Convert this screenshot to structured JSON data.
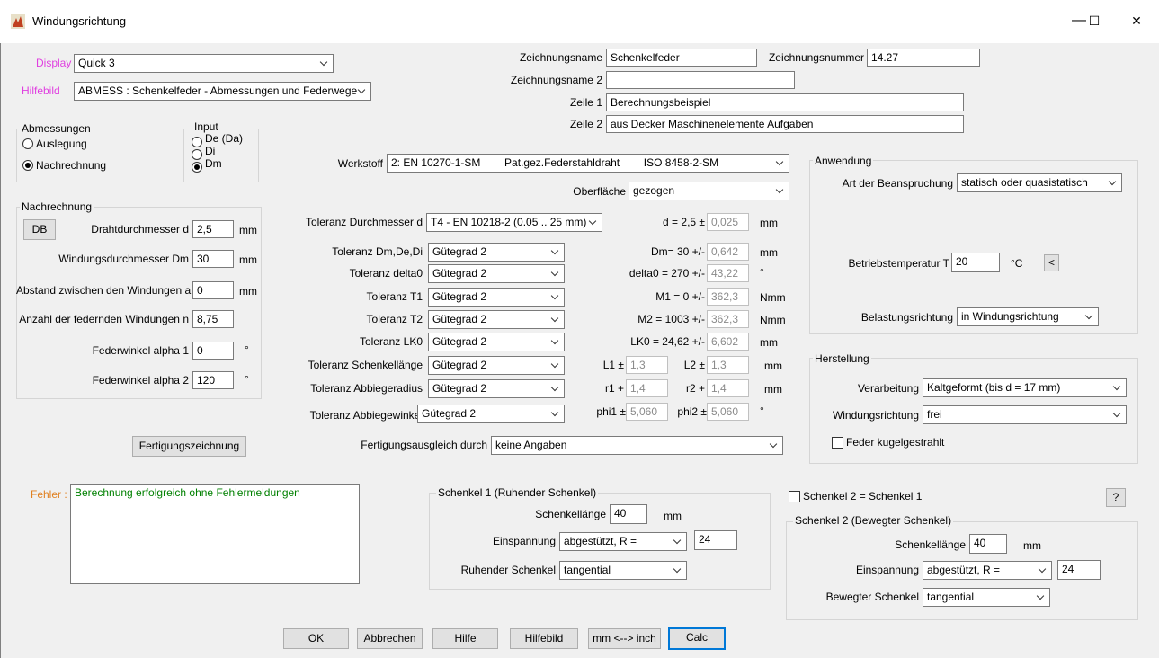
{
  "window": {
    "title": "Windungsrichtung",
    "minimize": "—",
    "maximize": "☐",
    "close": "✕"
  },
  "top": {
    "display_label": "Display",
    "display_value": "Quick 3",
    "hilfebild_label": "Hilfebild",
    "hilfebild_value": "ABMESS  : Schenkelfeder - Abmessungen und Federwege",
    "zeichnungsname_label": "Zeichnungsname",
    "zeichnungsname_value": "Schenkelfeder",
    "zeichnungsnummer_label": "Zeichnungsnummer",
    "zeichnungsnummer_value": "14.27",
    "zeichnungsname2_label": "Zeichnungsname 2",
    "zeichnungsname2_value": "",
    "zeile1_label": "Zeile 1",
    "zeile1_value": "Berechnungsbeispiel",
    "zeile2_label": "Zeile 2",
    "zeile2_value": "aus Decker Maschinenelemente Aufgaben"
  },
  "abmessungen": {
    "title": "Abmessungen",
    "auslegung": "Auslegung",
    "nachrechnung": "Nachrechnung"
  },
  "input_group": {
    "title": "Input",
    "de": "De (Da)",
    "di": "Di",
    "dm": "Dm"
  },
  "nachrechnung": {
    "title": "Nachrechnung",
    "db_button": "DB",
    "rows": [
      {
        "label": "Drahtdurchmesser d",
        "value": "2,5",
        "unit": "mm"
      },
      {
        "label": "Windungsdurchmesser Dm",
        "value": "30",
        "unit": "mm"
      },
      {
        "label": "Abstand zwischen den Windungen a",
        "value": "0",
        "unit": "mm"
      },
      {
        "label": "Anzahl der federnden Windungen n",
        "value": "8,75",
        "unit": ""
      },
      {
        "label": "Federwinkel alpha 1",
        "value": "0",
        "unit": "°"
      },
      {
        "label": "Federwinkel alpha 2",
        "value": "120",
        "unit": "°"
      }
    ]
  },
  "werkstoff": {
    "label": "Werkstoff",
    "value": "2: EN 10270-1-SM        Pat.gez.Federstahldraht        ISO 8458-2-SM",
    "oberflaeche_label": "Oberfläche",
    "oberflaeche_value": "gezogen"
  },
  "toleranz": {
    "rows": [
      {
        "label": "Toleranz Durchmesser d",
        "value": "T4 - EN 10218-2 (0.05 .. 25 mm)",
        "res_label": "d = 2,5 ±",
        "res_value": "0,025",
        "unit": "mm"
      },
      {
        "label": "Toleranz Dm,De,Di",
        "value": "Gütegrad 2",
        "res_label": "Dm= 30 +/-",
        "res_value": "0,642",
        "unit": "mm"
      },
      {
        "label": "Toleranz delta0",
        "value": "Gütegrad 2",
        "res_label": "delta0 = 270 +/-",
        "res_value": "43,22",
        "unit": "°"
      },
      {
        "label": "Toleranz T1",
        "value": "Gütegrad 2",
        "res_label": "M1 = 0 +/-",
        "res_value": "362,3",
        "unit": "Nmm"
      },
      {
        "label": "Toleranz T2",
        "value": "Gütegrad 2",
        "res_label": "M2 = 1003 +/-",
        "res_value": "362,3",
        "unit": "Nmm"
      },
      {
        "label": "Toleranz LK0",
        "value": "Gütegrad 2",
        "res_label": "LK0 = 24,62 +/-",
        "res_value": "6,602",
        "unit": "mm"
      }
    ],
    "schenkel": {
      "label": "Toleranz Schenkellänge",
      "value": "Gütegrad 2",
      "l1_label": "L1 ±",
      "l1_value": "1,3",
      "l2_label": "L2 ±",
      "l2_value": "1,3",
      "unit": "mm"
    },
    "radius": {
      "label": "Toleranz Abbiegeradius",
      "value": "Gütegrad 2",
      "r1_label": "r1 +",
      "r1_value": "1,4",
      "r2_label": "r2 +",
      "r2_value": "1,4",
      "unit": "mm"
    },
    "winkel": {
      "label": "Toleranz Abbiegewinkel",
      "value": "Gütegrad 2",
      "phi1_label": "phi1 ±",
      "phi1_value": "5,060",
      "phi2_label": "phi2 ±",
      "phi2_value": "5,060",
      "unit": "°"
    },
    "fertigungsausgleich_label": "Fertigungsausgleich durch",
    "fertigungsausgleich_value": "keine Angaben"
  },
  "anwendung": {
    "title": "Anwendung",
    "beanspruchung_label": "Art der Beanspruchung",
    "beanspruchung_value": "statisch oder quasistatisch",
    "temp_label": "Betriebstemperatur T",
    "temp_value": "20",
    "temp_unit": "°C",
    "temp_button": "<",
    "belastung_label": "Belastungsrichtung",
    "belastung_value": "in Windungsrichtung"
  },
  "herstellung": {
    "title": "Herstellung",
    "verarbeitung_label": "Verarbeitung",
    "verarbeitung_value": "Kaltgeformt (bis d = 17 mm)",
    "windung_label": "Windungsrichtung",
    "windung_value": "frei",
    "kugel_label": "Feder kugelgestrahlt"
  },
  "fertigungszeichnung_button": "Fertigungszeichnung",
  "fehler": {
    "label": "Fehler :",
    "text": "Berechnung erfolgreich ohne Fehlermeldungen"
  },
  "schenkel1": {
    "title": "Schenkel 1 (Ruhender Schenkel)",
    "laenge_label": "Schenkellänge",
    "laenge_value": "40",
    "laenge_unit": "mm",
    "einspannung_label": "Einspannung",
    "einspannung_value": "abgestützt, R =",
    "einspannung_r": "24",
    "ruhender_label": "Ruhender Schenkel",
    "ruhender_value": "tangential"
  },
  "schenkel2": {
    "equal_label": "Schenkel 2 = Schenkel 1",
    "help_button": "?",
    "title": "Schenkel 2 (Bewegter Schenkel)",
    "laenge_label": "Schenkellänge",
    "laenge_value": "40",
    "laenge_unit": "mm",
    "einspannung_label": "Einspannung",
    "einspannung_value": "abgestützt, R =",
    "einspannung_r": "24",
    "bewegter_label": "Bewegter Schenkel",
    "bewegter_value": "tangential"
  },
  "buttons": {
    "ok": "OK",
    "abbrechen": "Abbrechen",
    "hilfe": "Hilfe",
    "hilfebild": "Hilfebild",
    "mminch": "mm <--> inch",
    "calc": "Calc"
  }
}
